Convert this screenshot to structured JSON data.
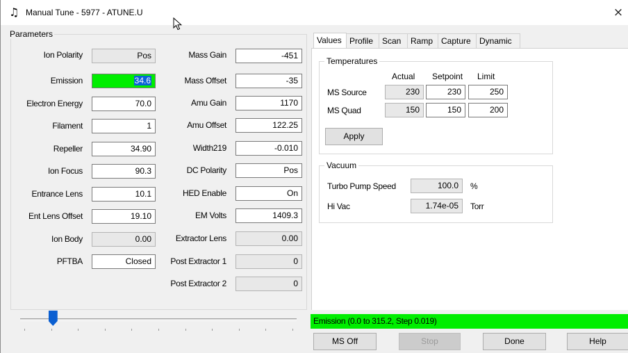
{
  "window": {
    "title": "Manual Tune - 5977 - ATUNE.U",
    "close_glyph": "×"
  },
  "parameters": {
    "title": "Parameters",
    "left_rows": [
      {
        "label": "Ion Polarity",
        "value": "Pos"
      },
      {
        "label": "Emission",
        "value": "34.6"
      },
      {
        "label": "Electron Energy",
        "value": "70.0"
      },
      {
        "label": "Filament",
        "value": "1"
      },
      {
        "label": "Repeller",
        "value": "34.90"
      },
      {
        "label": "Ion Focus",
        "value": "90.3"
      },
      {
        "label": "Entrance Lens",
        "value": "10.1"
      },
      {
        "label": "Ent Lens Offset",
        "value": "19.10"
      },
      {
        "label": "Ion Body",
        "value": "0.00"
      },
      {
        "label": "PFTBA",
        "value": "Closed"
      }
    ],
    "right_rows": [
      {
        "label": "Mass Gain",
        "value": "-451"
      },
      {
        "label": "Mass Offset",
        "value": "-35"
      },
      {
        "label": "Amu Gain",
        "value": "1170"
      },
      {
        "label": "Amu Offset",
        "value": "122.25"
      },
      {
        "label": "Width219",
        "value": "-0.010"
      },
      {
        "label": "DC Polarity",
        "value": "Pos"
      },
      {
        "label": "HED Enable",
        "value": "On"
      },
      {
        "label": "EM Volts",
        "value": "1409.3"
      },
      {
        "label": "Extractor Lens",
        "value": "0.00"
      },
      {
        "label": "Post Extractor 1",
        "value": "0"
      },
      {
        "label": "Post Extractor 2",
        "value": "0"
      }
    ],
    "slider_fraction": 0.11
  },
  "tabs": [
    "Values",
    "Profile",
    "Scan",
    "Ramp",
    "Capture",
    "Dynamic"
  ],
  "temperatures": {
    "title": "Temperatures",
    "columns": [
      "Actual",
      "Setpoint",
      "Limit"
    ],
    "rows": [
      {
        "label": "MS Source",
        "actual": "230",
        "setpoint": "230",
        "limit": "250"
      },
      {
        "label": "MS Quad",
        "actual": "150",
        "setpoint": "150",
        "limit": "200"
      }
    ],
    "apply_label": "Apply"
  },
  "vacuum": {
    "title": "Vacuum",
    "turbo_label": "Turbo Pump Speed",
    "turbo_value": "100.0",
    "turbo_unit": "%",
    "hivac_label": "Hi Vac",
    "hivac_value": "1.74e-05",
    "hivac_unit": "Torr"
  },
  "status": {
    "text": "Emission (0.0 to 315.2, Step 0.019)",
    "color": "#00ee00"
  },
  "buttons": {
    "ms_off": "MS Off",
    "stop": "Stop",
    "done": "Done",
    "help": "Help"
  }
}
